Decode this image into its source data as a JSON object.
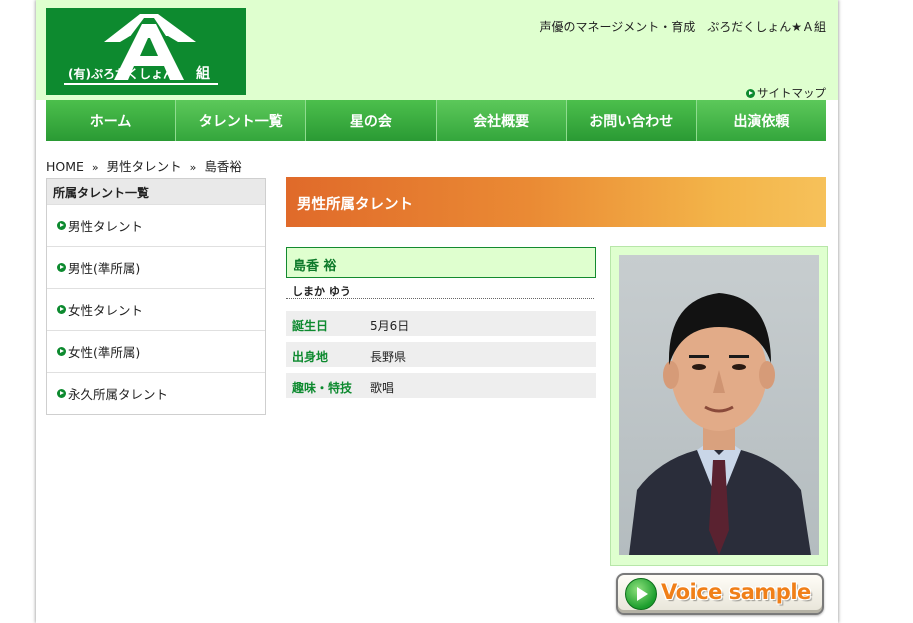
{
  "header": {
    "logo_text": "(有)ぷろだくしょん",
    "logo_letter": "A",
    "logo_suffix": "組",
    "tagline": "声優のマネージメント・育成　ぷろだくしょん★Ａ組",
    "sitemap_label": "サイトマップ"
  },
  "nav": {
    "items": [
      {
        "label": "ホーム"
      },
      {
        "label": "タレント一覧"
      },
      {
        "label": "星の会"
      },
      {
        "label": "会社概要"
      },
      {
        "label": "お問い合わせ"
      },
      {
        "label": "出演依頼"
      }
    ]
  },
  "breadcrumb": {
    "home": "HOME",
    "category": "男性タレント",
    "current": "島香裕",
    "separator": "»"
  },
  "sidebar": {
    "title": "所属タレント一覧",
    "items": [
      {
        "label": "男性タレント"
      },
      {
        "label": "男性(準所属)"
      },
      {
        "label": "女性タレント"
      },
      {
        "label": "女性(準所属)"
      },
      {
        "label": "永久所属タレント"
      }
    ]
  },
  "section": {
    "title": "男性所属タレント"
  },
  "profile": {
    "name": "島香 裕",
    "reading": "しまか ゆう",
    "rows": [
      {
        "label": "誕生日",
        "value": "5月6日"
      },
      {
        "label": "出身地",
        "value": "長野県"
      },
      {
        "label": "趣味・特技",
        "value": "歌唱"
      }
    ]
  },
  "voice_button": {
    "label": "Voice sample"
  },
  "colors": {
    "brand_green": "#0d8a2f",
    "header_bg": "#dfffcf",
    "nav_green": "#3cb043",
    "banner_orange": "#e06a2a"
  }
}
